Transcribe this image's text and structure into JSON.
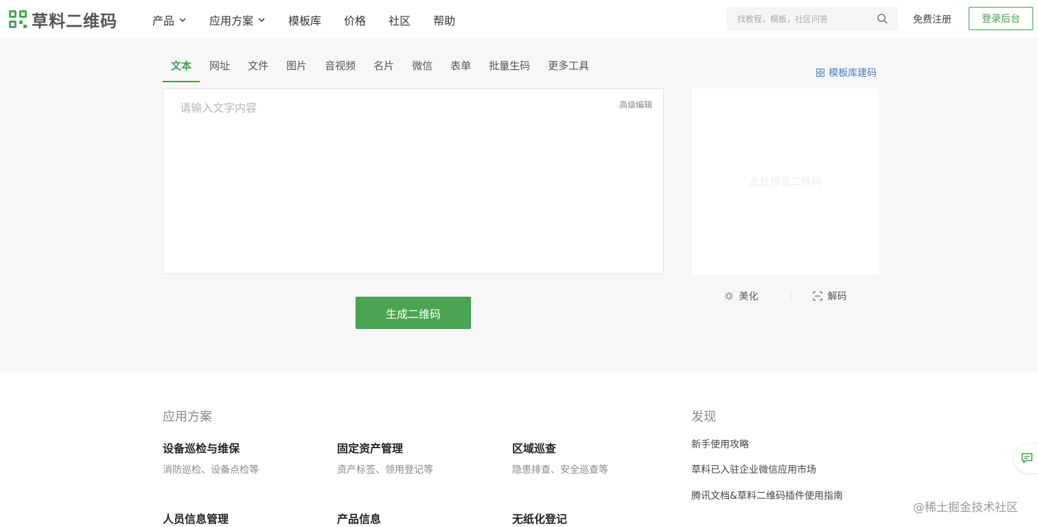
{
  "colors": {
    "brand": "#3e9f45",
    "link": "#4a7ec7",
    "main_bg": "#f7f7f7"
  },
  "header": {
    "logo_text": "草料二维码",
    "nav": [
      {
        "label": "产品",
        "dropdown": true
      },
      {
        "label": "应用方案",
        "dropdown": true
      },
      {
        "label": "模板库",
        "dropdown": false
      },
      {
        "label": "价格",
        "dropdown": false
      },
      {
        "label": "社区",
        "dropdown": false
      },
      {
        "label": "帮助",
        "dropdown": false
      }
    ],
    "search": {
      "placeholder": "找教程，模板，社区问答",
      "value": ""
    },
    "register_label": "免费注册",
    "login_label": "登录后台"
  },
  "tabs": [
    "文本",
    "网址",
    "文件",
    "图片",
    "音视频",
    "名片",
    "微信",
    "表单",
    "批量生码",
    "更多工具"
  ],
  "active_tab": "文本",
  "template_link": "模板库建码",
  "editor": {
    "placeholder": "请输入文字内容",
    "value": "",
    "advanced_label": "高级编辑"
  },
  "generate_label": "生成二维码",
  "preview": {
    "placeholder": "此处预览二维码"
  },
  "tools": {
    "beautify": "美化",
    "decode": "解码"
  },
  "footer": {
    "solutions_title": "应用方案",
    "solutions": [
      {
        "title": "设备巡检与维保",
        "sub": "消防巡检、设备点检等"
      },
      {
        "title": "固定资产管理",
        "sub": "资产标签、领用登记等"
      },
      {
        "title": "区域巡查",
        "sub": "隐患排查、安全巡查等"
      },
      {
        "title": "人员信息管理",
        "sub": ""
      },
      {
        "title": "产品信息",
        "sub": ""
      },
      {
        "title": "无纸化登记",
        "sub": ""
      }
    ],
    "discover_title": "发现",
    "discover": [
      "新手使用攻略",
      "草料已入驻企业微信应用市场",
      "腾讯文档&草料二维码插件使用指南"
    ]
  },
  "watermark": "@稀土掘金技术社区"
}
